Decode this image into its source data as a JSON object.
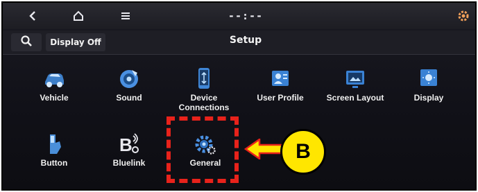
{
  "status_bar": {
    "back_icon": "back-chevron-icon",
    "home_icon": "home-icon",
    "menu_icon": "menu-icon",
    "clock": "--:--",
    "settings_icon": "gear-status-icon"
  },
  "header": {
    "search_icon": "search-icon",
    "display_off_label": "Display Off",
    "title": "Setup"
  },
  "menu": {
    "items": [
      {
        "label": "Vehicle",
        "icon": "vehicle-icon"
      },
      {
        "label": "Sound",
        "icon": "sound-icon"
      },
      {
        "label": "Device\nConnections",
        "icon": "device-connections-icon"
      },
      {
        "label": "User Profile",
        "icon": "user-profile-icon"
      },
      {
        "label": "Screen Layout",
        "icon": "screen-layout-icon"
      },
      {
        "label": "Display",
        "icon": "display-icon"
      },
      {
        "label": "Button",
        "icon": "button-icon"
      },
      {
        "label": "Bluelink",
        "icon": "bluelink-icon"
      },
      {
        "label": "General",
        "icon": "general-icon"
      }
    ]
  },
  "callout": {
    "badge": "B",
    "color": "#e8221b",
    "badge_color": "#ffe600"
  }
}
